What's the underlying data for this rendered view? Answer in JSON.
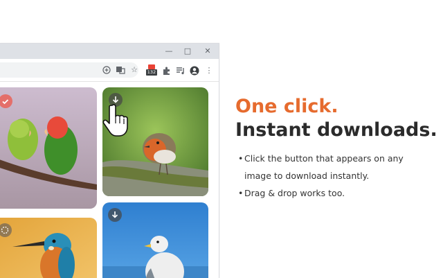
{
  "window": {
    "minimize_icon": "minimize-icon",
    "maximize_icon": "maximize-icon",
    "close_icon": "close-icon"
  },
  "toolbar": {
    "icons": [
      "add-icon",
      "translate-icon",
      "star-icon",
      "extension-badge-icon",
      "puzzle-icon",
      "playlist-icon",
      "account-icon",
      "menu-kebab-icon"
    ],
    "extension_badge_count": "132"
  },
  "photos": [
    {
      "name": "lovebirds",
      "overlay": "check-icon"
    },
    {
      "name": "robin",
      "overlay": "download-icon"
    },
    {
      "name": "kingfisher",
      "overlay": "loading-icon"
    },
    {
      "name": "seagull",
      "overlay": "download-icon"
    }
  ],
  "promo": {
    "headline_1": "One click.",
    "headline_2": "Instant downloads.",
    "bullets": [
      "Click the button that appears on any",
      "image to download instantly.",
      "Drag & drop works too."
    ],
    "accent_color": "#e66b2e",
    "text_color": "#2b2b2b"
  }
}
